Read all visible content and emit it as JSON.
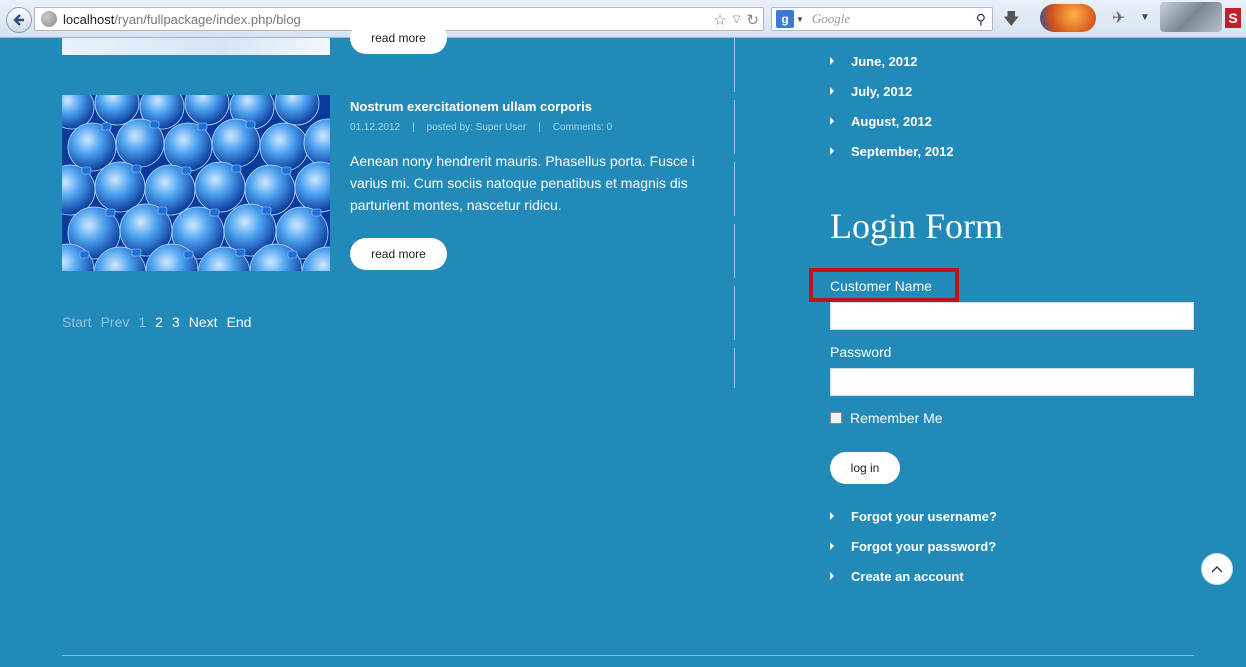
{
  "browser": {
    "url_host": "localhost",
    "url_path": "/ryan/fullpackage/index.php/blog",
    "search_placeholder": "Google",
    "search_engine_letter": "g",
    "ext_badge": "S"
  },
  "posts": {
    "top_read_more": "read more",
    "post": {
      "title": "Nostrum exercitationem ullam corporis",
      "date": "01.12.2012",
      "sep": "|",
      "author": "posted by: Super User",
      "comments": "Comments: 0",
      "body": "Aenean nony hendrerit mauris. Phasellus porta. Fusce i varius mi. Cum sociis natoque penatibus et magnis dis parturient montes, nascetur ridicu.",
      "read_more": "read more"
    }
  },
  "pagination": {
    "start": "Start",
    "prev": "Prev",
    "pages": [
      "1",
      "2",
      "3"
    ],
    "next": "Next",
    "end": "End"
  },
  "archive": {
    "items": [
      "June, 2012",
      "July, 2012",
      "August, 2012",
      "September, 2012"
    ]
  },
  "login": {
    "title": "Login Form",
    "username_label": "Customer Name",
    "password_label": "Password",
    "remember_label": "Remember Me",
    "submit_label": "log in",
    "links": [
      "Forgot your username?",
      "Forgot your password?",
      "Create an account"
    ]
  },
  "colors": {
    "page_bg": "#218ab8",
    "highlight": "#c1121c"
  }
}
